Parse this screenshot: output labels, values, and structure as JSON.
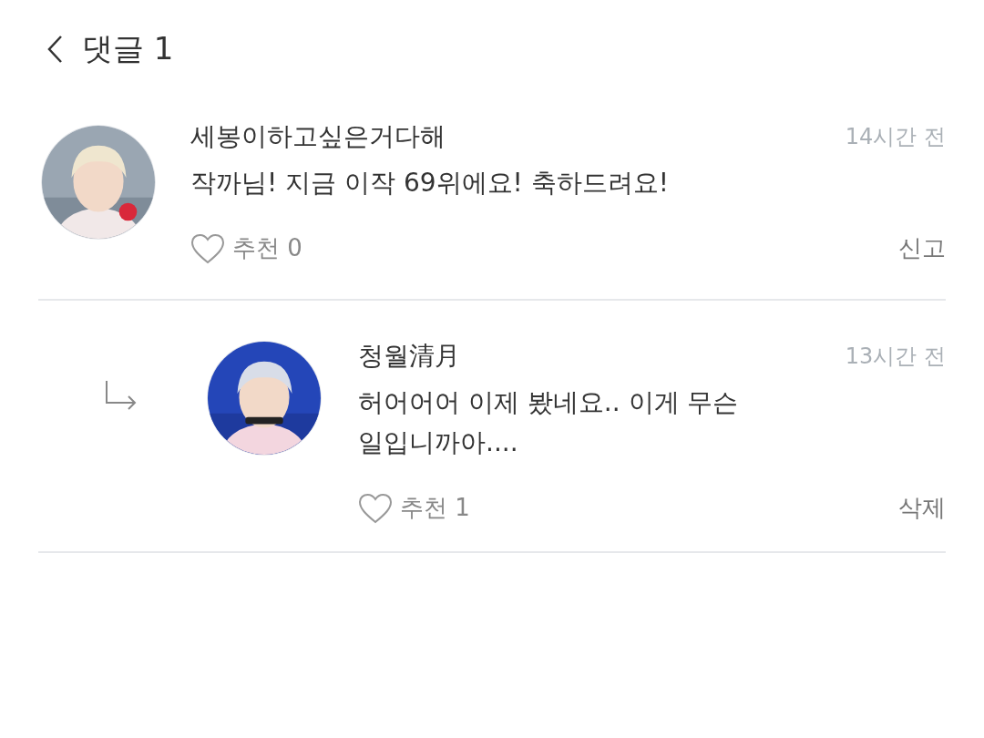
{
  "header": {
    "title": "댓글 1"
  },
  "comments": [
    {
      "kind": "comment",
      "author": "세봉이하고싶은거다해",
      "time": "14시간 전",
      "text": "작까님! 지금 이작 69위에요! 축하드려요!",
      "likes": "추천 0",
      "action": "신고"
    },
    {
      "kind": "reply",
      "author": "청월清月",
      "time": "13시간 전",
      "text": "허어어어 이제 봤네요.. 이게 무슨 일입니까아....",
      "likes": "추천 1",
      "action": "삭제"
    }
  ]
}
